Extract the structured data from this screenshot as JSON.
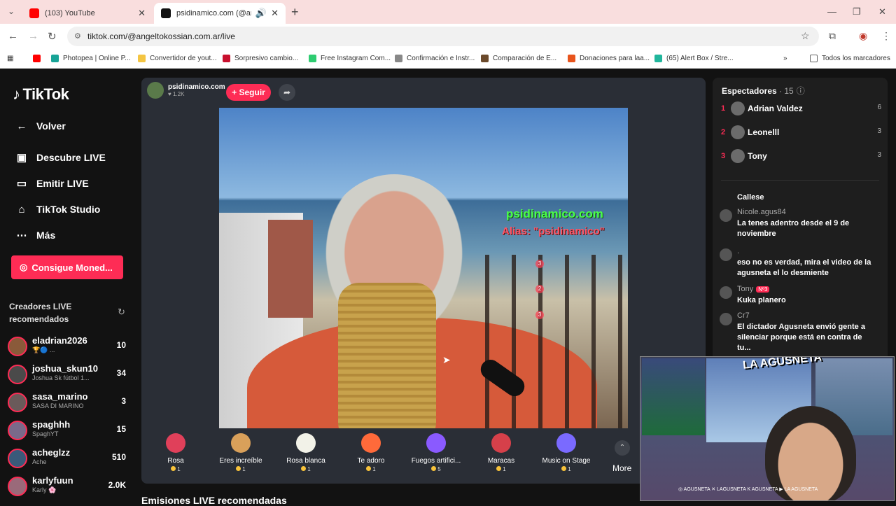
{
  "browser": {
    "tabs": [
      {
        "title": "(103) YouTube",
        "active": false
      },
      {
        "title": "psidinamico.com (@angelt...",
        "active": true
      }
    ],
    "url": "tiktok.com/@angeltokossian.com.ar/live",
    "bookmarks": [
      "Photopea | Online P...",
      "Convertidor de yout...",
      "Sorpresivo cambio...",
      "Free Instagram Com...",
      "Confirmación e Instr...",
      "Comparación de E...",
      "Donaciones para laa...",
      "(65) Alert Box / Stre...",
      "Todos los marcadores"
    ]
  },
  "sidebar": {
    "logo": "TikTok",
    "items": [
      {
        "label": "Volver",
        "icon": "back-arrow-icon"
      },
      {
        "label": "Descubre LIVE",
        "icon": "live-tv-icon"
      },
      {
        "label": "Emitir LIVE",
        "icon": "camera-icon"
      },
      {
        "label": "TikTok Studio",
        "icon": "studio-icon"
      },
      {
        "label": "Más",
        "icon": "more-dots-icon"
      }
    ],
    "coins_button": "Consigue Moned...",
    "creators_heading": "Creadores LIVE recomendados",
    "creators": [
      {
        "name": "eladrian2026",
        "sub": "🏆🔵 ...",
        "count": "10"
      },
      {
        "name": "joshua_skun10",
        "sub": "Joshua Sk fútbol 1...",
        "count": "34"
      },
      {
        "name": "sasa_marino",
        "sub": "SASA DI MARINO",
        "count": "3"
      },
      {
        "name": "spaghhh",
        "sub": "SpaghYT",
        "count": "15"
      },
      {
        "name": "acheglzz",
        "sub": "Ache",
        "count": "510"
      },
      {
        "name": "karlyfuun",
        "sub": "Karly 🌸",
        "count": "2.0K"
      }
    ]
  },
  "live": {
    "host_name": "psidinamico.com",
    "host_likes": "1.2K",
    "follow_label": "+ Seguir",
    "overlay_line1": "psidinamico.com",
    "overlay_line2": "Alias: \"psidinamico\"",
    "overlay_ranks": [
      "3",
      "2",
      "3"
    ],
    "gifts": [
      {
        "name": "Rosa",
        "price": "1",
        "color": "#e0405a"
      },
      {
        "name": "Eres increíble",
        "price": "1",
        "color": "#d9a05a"
      },
      {
        "name": "Rosa blanca",
        "price": "1",
        "color": "#f2f2e8"
      },
      {
        "name": "Te adoro",
        "price": "1",
        "color": "#ff6a3a"
      },
      {
        "name": "Fuegos artifici...",
        "price": "5",
        "color": "#8a5aff"
      },
      {
        "name": "Maracas",
        "price": "1",
        "color": "#d6404a"
      },
      {
        "name": "Music on Stage",
        "price": "1",
        "color": "#7a6aff"
      }
    ],
    "more_label": "More",
    "recommended_heading": "Emisiones LIVE recomendadas"
  },
  "viewers": {
    "heading": "Espectadores",
    "count": "· 15",
    "list": [
      {
        "rank": "1",
        "name": "Adrian Valdez",
        "score": "6"
      },
      {
        "rank": "2",
        "name": "Leonelll",
        "score": "3"
      },
      {
        "rank": "3",
        "name": "Tony",
        "score": "3"
      }
    ]
  },
  "chat": [
    {
      "user": "",
      "text": "Callese",
      "badge": ""
    },
    {
      "user": "Nicole.agus84",
      "text": "La tenes adentro desde el 9 de noviembre",
      "badge": ""
    },
    {
      "user": ".",
      "text": "eso no es verdad, mira el video de la agusneta el lo desmiente",
      "badge": ""
    },
    {
      "user": "Tony",
      "text": "Kuka planero",
      "badge": "Nº3"
    },
    {
      "user": "Cr7",
      "text": "El dictador Agusneta envió gente a silenciar porque está en contra de tu...",
      "badge": ""
    }
  ],
  "streamer_cam": {
    "brand": "LA AGUSNETA",
    "footer": "◎ AGUSNETA  ✕ LAGUSNETA  K AGUSNETA  ▶ LA AGUSNETA"
  }
}
